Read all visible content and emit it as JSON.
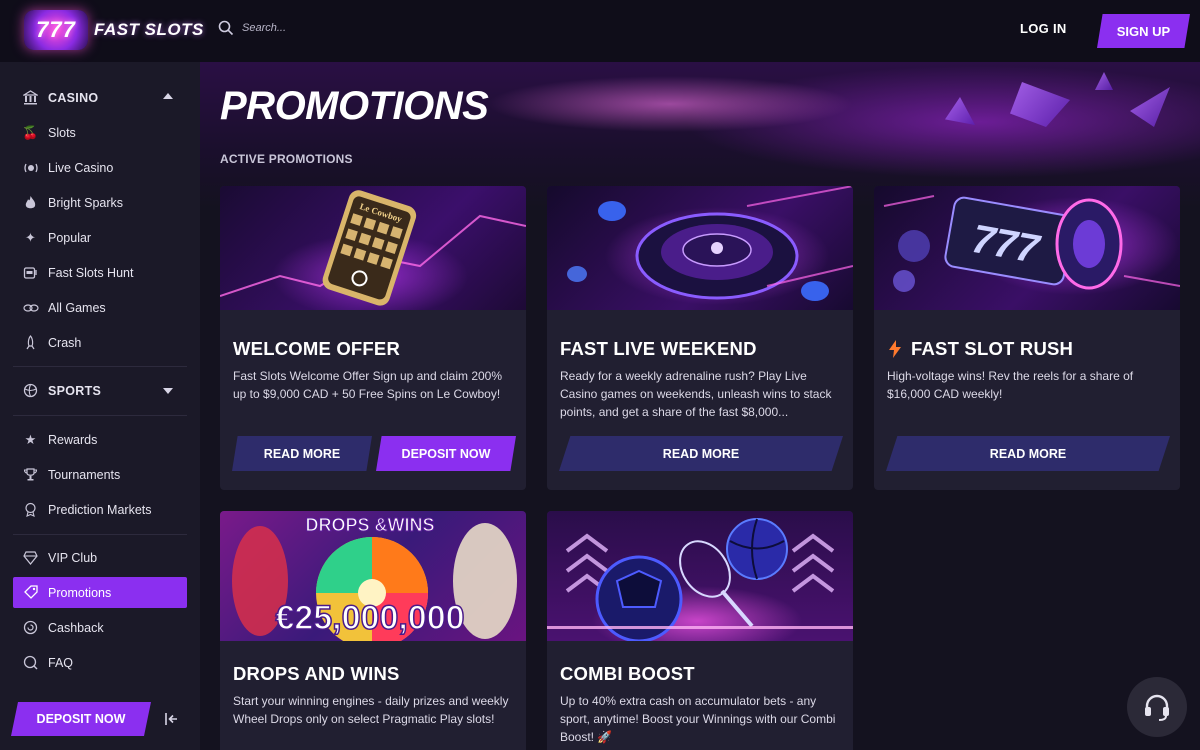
{
  "header": {
    "logo_number": "777",
    "logo_text": "FAST SLOTS",
    "search_placeholder": "Search...",
    "login_label": "LOG IN",
    "signup_label": "SIGN UP"
  },
  "sidebar": {
    "casino_label": "CASINO",
    "casino_items": [
      {
        "label": "Slots",
        "icon": "cherry-icon"
      },
      {
        "label": "Live Casino",
        "icon": "live-icon"
      },
      {
        "label": "Bright Sparks",
        "icon": "flame-icon"
      },
      {
        "label": "Popular",
        "icon": "sparkle-icon"
      },
      {
        "label": "Fast Slots Hunt",
        "icon": "slot-machine-icon"
      },
      {
        "label": "All Games",
        "icon": "all-games-icon"
      },
      {
        "label": "Crash",
        "icon": "rocket-icon"
      }
    ],
    "sports_label": "SPORTS",
    "extra_items": [
      {
        "label": "Rewards",
        "icon": "star-icon"
      },
      {
        "label": "Tournaments",
        "icon": "trophy-icon"
      },
      {
        "label": "Prediction Markets",
        "icon": "medal-icon"
      }
    ],
    "bottom_items": [
      {
        "label": "VIP Club",
        "icon": "diamond-icon"
      },
      {
        "label": "Promotions",
        "icon": "promotion-icon"
      },
      {
        "label": "Cashback",
        "icon": "cashback-icon"
      },
      {
        "label": "FAQ",
        "icon": "faq-icon"
      }
    ],
    "active_item": "Promotions",
    "deposit_label": "DEPOSIT NOW"
  },
  "main": {
    "title": "PROMOTIONS",
    "section_label": "ACTIVE PROMOTIONS",
    "promos": [
      {
        "title": "WELCOME OFFER",
        "description": "Fast Slots Welcome Offer Sign up and claim 200% up to $9,000 CAD + 50 Free Spins on Le Cowboy!",
        "read_more": "READ MORE",
        "deposit": "DEPOSIT NOW",
        "image_text": "Le Cowboy"
      },
      {
        "title": "FAST LIVE WEEKEND",
        "description": "Ready for a weekly adrenaline rush? Play Live Casino games on weekends, unleash wins to stack points, and get a share of the fast $8,000...",
        "read_more": "READ MORE"
      },
      {
        "title": "FAST SLOT RUSH",
        "description": "High-voltage wins! Rev the reels for a share of $16,000 CAD weekly!",
        "read_more": "READ MORE",
        "image_text": "777"
      },
      {
        "title": "DROPS AND WINS",
        "description": "Start your winning engines - daily prizes and weekly Wheel Drops only on select Pragmatic Play slots!",
        "image_text_top": "DROPS &WINS",
        "image_amount": "€25,000,000"
      },
      {
        "title": "COMBI BOOST",
        "description": "Up to 40% extra cash on accumulator bets - any sport, anytime! Boost your Winnings with our Combi Boost! 🚀"
      }
    ]
  },
  "colors": {
    "accent": "#8b2ff0",
    "button_dark": "#2e2c6b",
    "card_bg": "#211f31",
    "sidebar_bg": "#1b1928",
    "page_bg": "#14121f"
  }
}
